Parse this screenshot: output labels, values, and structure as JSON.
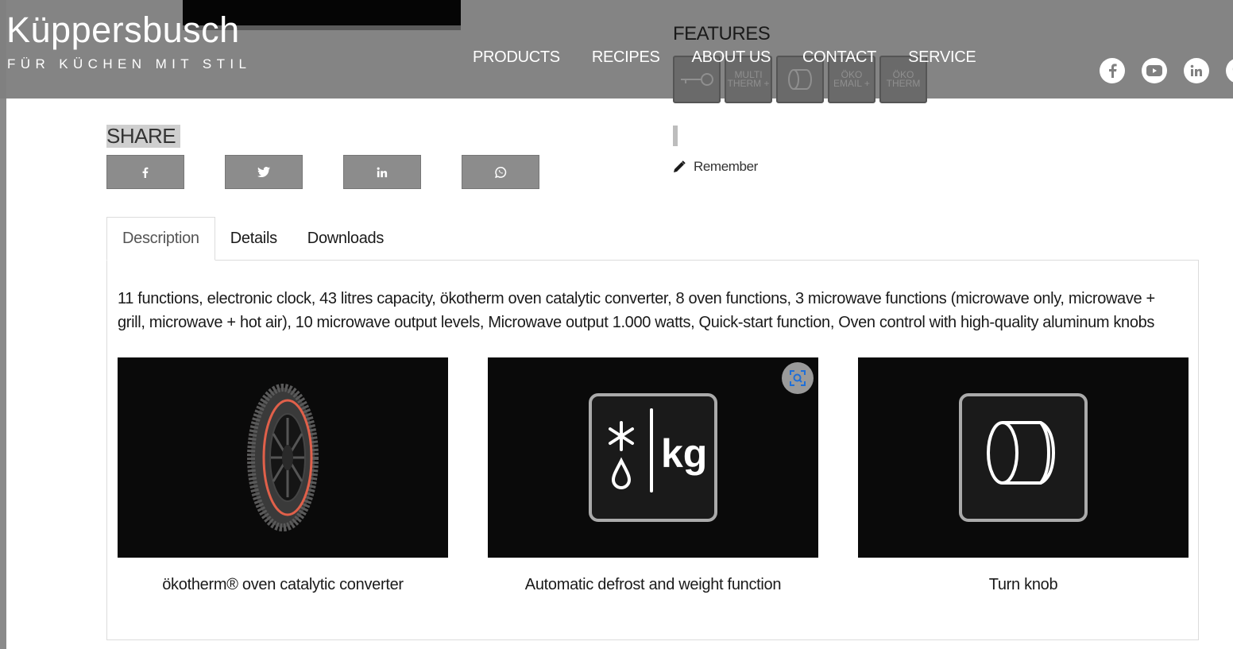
{
  "brand": {
    "name": "Küppersbusch",
    "tagline": "FÜR KÜCHEN MIT STIL"
  },
  "nav": {
    "items": [
      {
        "label": "PRODUCTS"
      },
      {
        "label": "RECIPES"
      },
      {
        "label": "ABOUT US"
      },
      {
        "label": "CONTACT"
      },
      {
        "label": "SERVICE"
      }
    ]
  },
  "features": {
    "title": "FEATURES",
    "icons": [
      {
        "name": "key-icon",
        "text": ""
      },
      {
        "name": "multi-therm-plus-icon",
        "text": "MULTI THERM +"
      },
      {
        "name": "turn-knob-icon",
        "text": ""
      },
      {
        "name": "oko-email-plus-icon",
        "text": "ÖKO EMAIL +"
      },
      {
        "name": "oko-therm-icon",
        "text": "ÖKO THERM"
      }
    ]
  },
  "social": [
    "facebook-icon",
    "youtube-icon",
    "linkedin-icon",
    "pinterest-icon"
  ],
  "share": {
    "label": "SHARE",
    "buttons": [
      "facebook",
      "twitter",
      "linkedin",
      "whatsapp"
    ]
  },
  "remember": {
    "label": "Remember"
  },
  "tabs": [
    {
      "label": "Description",
      "active": true
    },
    {
      "label": "Details",
      "active": false
    },
    {
      "label": "Downloads",
      "active": false
    }
  ],
  "description": {
    "text": "11 functions, electronic clock, 43 litres capacity, ökotherm oven catalytic converter, 8 oven functions, 3 microwave functions (microwave only, microwave + grill, microwave + hot air), 10 microwave output levels, Microwave output 1.000 watts, Quick-start function, Oven control with high-quality aluminum knobs"
  },
  "cards": [
    {
      "caption": "ökotherm® oven catalytic converter"
    },
    {
      "caption": "Automatic defrost and weight function",
      "icon_text": "kg"
    },
    {
      "caption": "Turn knob"
    }
  ],
  "colors": {
    "header_bg": "#808080",
    "button_bg": "#8c8c8c",
    "card_bg": "#0a0a0a"
  }
}
